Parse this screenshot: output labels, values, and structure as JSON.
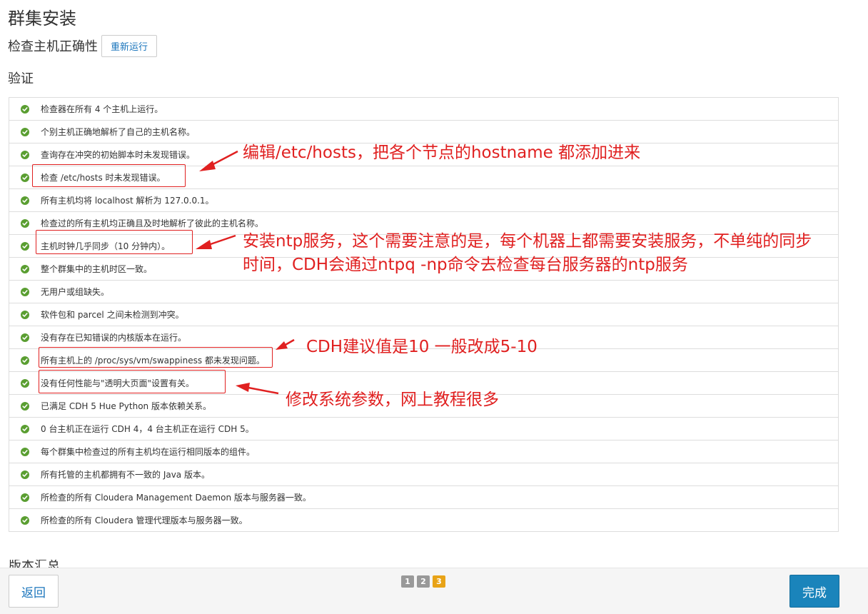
{
  "page": {
    "title": "群集安装"
  },
  "inspect": {
    "subtitle": "检查主机正确性",
    "rerun_label": "重新运行"
  },
  "validation": {
    "title": "验证",
    "items": [
      "检查器在所有 4 个主机上运行。",
      "个别主机正确地解析了自己的主机名称。",
      "查询存在冲突的初始脚本时未发现错误。",
      "检查 /etc/hosts 时未发现错误。",
      "所有主机均将 localhost 解析为 127.0.0.1。",
      "检查过的所有主机均正确且及时地解析了彼此的主机名称。",
      "主机时钟几乎同步（10 分钟内）。",
      "整个群集中的主机时区一致。",
      "无用户或组缺失。",
      "软件包和 parcel 之间未检测到冲突。",
      "没有存在已知错误的内核版本在运行。",
      "所有主机上的 /proc/sys/vm/swappiness 都未发现问题。",
      "没有任何性能与\"透明大页面\"设置有关。",
      "已满足 CDH 5 Hue Python 版本依赖关系。",
      "0 台主机正在运行 CDH 4，4 台主机正在运行 CDH 5。",
      "每个群集中检查过的所有主机均在运行相同版本的组件。",
      "所有托管的主机都拥有不一致的 Java 版本。",
      "所检查的所有 Cloudera Management Daemon 版本与服务器一致。",
      "所检查的所有 Cloudera 管理代理版本与服务器一致。"
    ],
    "next_heading_partial": "版本汇总"
  },
  "annotations": {
    "hosts": "编辑/etc/hosts，把各个节点的hostname 都添加进来",
    "ntp_line1": "安装ntp服务，这个需要注意的是，每个机器上都需要安装服务，不单纯的同步",
    "ntp_line2": "时间，CDH会通过ntpq -np命令去检查每台服务器的ntp服务",
    "swappiness": "CDH建议值是10 一般改成5-10",
    "thp": "修改系统参数，网上教程很多"
  },
  "footer": {
    "back_label": "返回",
    "finish_label": "完成",
    "steps": [
      "1",
      "2",
      "3"
    ],
    "active_step": "3"
  },
  "colors": {
    "accent": "#1a84bb",
    "check": "#5a9e31",
    "annotation": "#e02020",
    "active_step": "#e8a317"
  }
}
